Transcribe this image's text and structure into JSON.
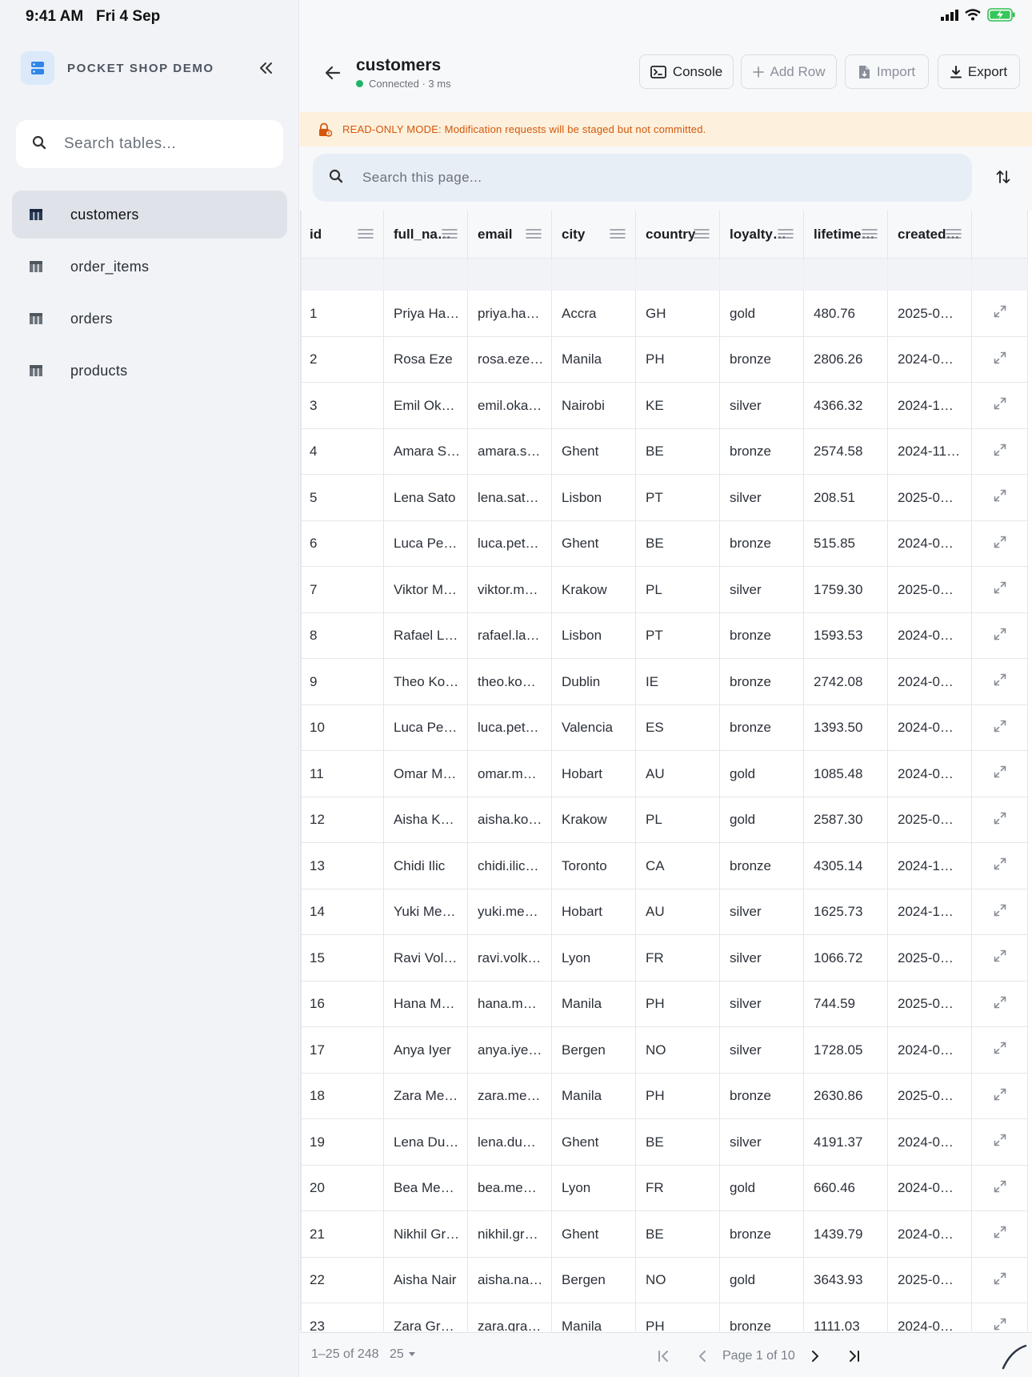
{
  "status": {
    "time": "9:41 AM",
    "date": "Fri 4 Sep"
  },
  "sidebar": {
    "brand": "POCKET SHOP DEMO",
    "search_placeholder": "Search tables...",
    "items": [
      {
        "label": "customers",
        "active": true
      },
      {
        "label": "order_items",
        "active": false
      },
      {
        "label": "orders",
        "active": false
      },
      {
        "label": "products",
        "active": false
      }
    ]
  },
  "header": {
    "title": "customers",
    "connection": "Connected · 3 ms",
    "console_label": "Console",
    "addrow_label": "Add Row",
    "import_label": "Import",
    "export_label": "Export"
  },
  "banner": {
    "text": "READ-ONLY MODE: Modification requests will be staged but not committed."
  },
  "search": {
    "placeholder": "Search this page..."
  },
  "table": {
    "columns": [
      "id",
      "full_na…",
      "email",
      "city",
      "country",
      "loyalty…",
      "lifetime…",
      "created…"
    ],
    "rows": [
      [
        "1",
        "Priya Ha…",
        "priya.ha…",
        "Accra",
        "GH",
        "gold",
        "480.76",
        "2025-0…"
      ],
      [
        "2",
        "Rosa Eze",
        "rosa.eze…",
        "Manila",
        "PH",
        "bronze",
        "2806.26",
        "2024-0…"
      ],
      [
        "3",
        "Emil Ok…",
        "emil.oka…",
        "Nairobi",
        "KE",
        "silver",
        "4366.32",
        "2024-1…"
      ],
      [
        "4",
        "Amara S…",
        "amara.s…",
        "Ghent",
        "BE",
        "bronze",
        "2574.58",
        "2024-11…"
      ],
      [
        "5",
        "Lena Sato",
        "lena.sat…",
        "Lisbon",
        "PT",
        "silver",
        "208.51",
        "2025-0…"
      ],
      [
        "6",
        "Luca Pet…",
        "luca.pet…",
        "Ghent",
        "BE",
        "bronze",
        "515.85",
        "2024-0…"
      ],
      [
        "7",
        "Viktor M…",
        "viktor.m…",
        "Krakow",
        "PL",
        "silver",
        "1759.30",
        "2025-0…"
      ],
      [
        "8",
        "Rafael L…",
        "rafael.la…",
        "Lisbon",
        "PT",
        "bronze",
        "1593.53",
        "2024-0…"
      ],
      [
        "9",
        "Theo Ko…",
        "theo.ko…",
        "Dublin",
        "IE",
        "bronze",
        "2742.08",
        "2024-0…"
      ],
      [
        "10",
        "Luca Pet…",
        "luca.pet…",
        "Valencia",
        "ES",
        "bronze",
        "1393.50",
        "2024-0…"
      ],
      [
        "11",
        "Omar M…",
        "omar.m…",
        "Hobart",
        "AU",
        "gold",
        "1085.48",
        "2024-0…"
      ],
      [
        "12",
        "Aisha Ko…",
        "aisha.ko…",
        "Krakow",
        "PL",
        "gold",
        "2587.30",
        "2025-0…"
      ],
      [
        "13",
        "Chidi Ilic",
        "chidi.ilic…",
        "Toronto",
        "CA",
        "bronze",
        "4305.14",
        "2024-1…"
      ],
      [
        "14",
        "Yuki Me…",
        "yuki.me…",
        "Hobart",
        "AU",
        "silver",
        "1625.73",
        "2024-1…"
      ],
      [
        "15",
        "Ravi Vol…",
        "ravi.volk…",
        "Lyon",
        "FR",
        "silver",
        "1066.72",
        "2025-0…"
      ],
      [
        "16",
        "Hana Me…",
        "hana.m…",
        "Manila",
        "PH",
        "silver",
        "744.59",
        "2025-0…"
      ],
      [
        "17",
        "Anya Iyer",
        "anya.iye…",
        "Bergen",
        "NO",
        "silver",
        "1728.05",
        "2024-0…"
      ],
      [
        "18",
        "Zara Me…",
        "zara.me…",
        "Manila",
        "PH",
        "bronze",
        "2630.86",
        "2025-0…"
      ],
      [
        "19",
        "Lena Du…",
        "lena.du…",
        "Ghent",
        "BE",
        "silver",
        "4191.37",
        "2024-0…"
      ],
      [
        "20",
        "Bea Men…",
        "bea.me…",
        "Lyon",
        "FR",
        "gold",
        "660.46",
        "2024-0…"
      ],
      [
        "21",
        "Nikhil Gr…",
        "nikhil.gr…",
        "Ghent",
        "BE",
        "bronze",
        "1439.79",
        "2024-0…"
      ],
      [
        "22",
        "Aisha Nair",
        "aisha.na…",
        "Bergen",
        "NO",
        "gold",
        "3643.93",
        "2025-0…"
      ],
      [
        "23",
        "Zara Gra…",
        "zara.gra…",
        "Manila",
        "PH",
        "bronze",
        "1111.03",
        "2024-0…"
      ]
    ]
  },
  "footer": {
    "range": "1–25 of 248",
    "page_size": "25",
    "page_label": "Page 1 of 10"
  },
  "colors": {
    "accent": "#1fb46a",
    "warning": "#d4570b",
    "banner_bg": "#fdf0dc"
  }
}
